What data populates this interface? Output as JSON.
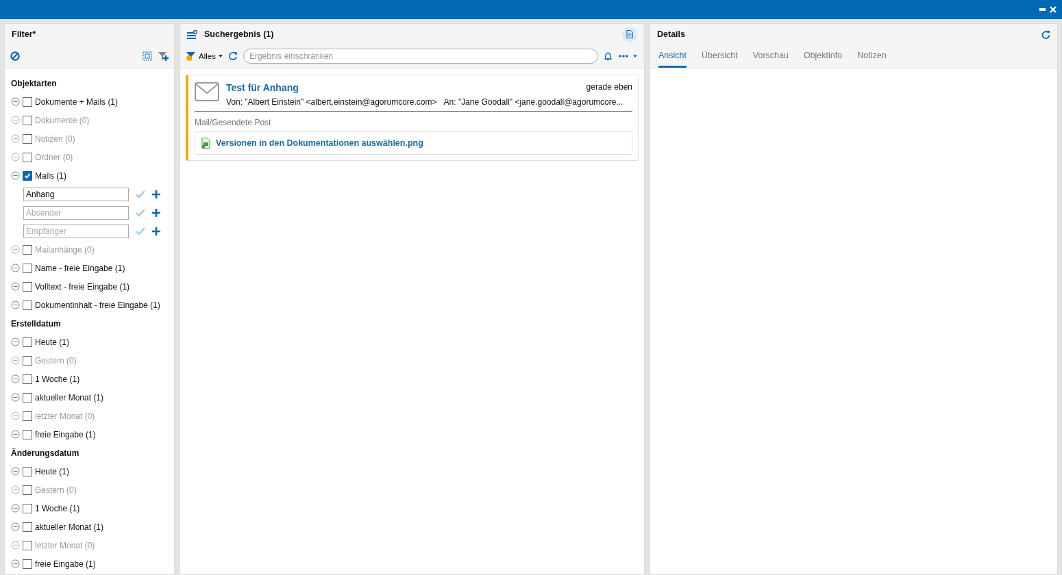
{
  "filter": {
    "title": "Filter*",
    "sections": [
      {
        "heading": "Objektarten",
        "items": [
          {
            "label": "Dokumente + Mails (1)",
            "checked": false,
            "disabled": false
          },
          {
            "label": "Dokumente (0)",
            "checked": false,
            "disabled": true
          },
          {
            "label": "Notizen (0)",
            "checked": false,
            "disabled": true
          },
          {
            "label": "Ordner (0)",
            "checked": false,
            "disabled": true
          },
          {
            "label": "Mails (1)",
            "checked": true,
            "disabled": false,
            "fields": [
              {
                "value": "Anhang"
              },
              {
                "placeholder": "Absender"
              },
              {
                "placeholder": "Empfänger"
              }
            ]
          },
          {
            "label": "Mailanhänge (0)",
            "checked": false,
            "disabled": true
          },
          {
            "label": "Name - freie Eingabe (1)",
            "checked": false,
            "disabled": false
          },
          {
            "label": "Volltext - freie Eingabe (1)",
            "checked": false,
            "disabled": false
          },
          {
            "label": "Dokumentinhalt - freie Eingabe (1)",
            "checked": false,
            "disabled": false
          }
        ]
      },
      {
        "heading": "Erstelldatum",
        "items": [
          {
            "label": "Heute (1)",
            "checked": false,
            "disabled": false
          },
          {
            "label": "Gestern (0)",
            "checked": false,
            "disabled": true
          },
          {
            "label": "1 Woche (1)",
            "checked": false,
            "disabled": false
          },
          {
            "label": "aktueller Monat (1)",
            "checked": false,
            "disabled": false
          },
          {
            "label": "letzter Monat (0)",
            "checked": false,
            "disabled": true
          },
          {
            "label": "freie Eingabe (1)",
            "checked": false,
            "disabled": false
          }
        ]
      },
      {
        "heading": "Änderungsdatum",
        "items": [
          {
            "label": "Heute (1)",
            "checked": false,
            "disabled": false
          },
          {
            "label": "Gestern (0)",
            "checked": false,
            "disabled": true
          },
          {
            "label": "1 Woche (1)",
            "checked": false,
            "disabled": false
          },
          {
            "label": "aktueller Monat (1)",
            "checked": false,
            "disabled": false
          },
          {
            "label": "letzter Monat (0)",
            "checked": false,
            "disabled": true
          },
          {
            "label": "freie Eingabe (1)",
            "checked": false,
            "disabled": false
          }
        ]
      }
    ]
  },
  "results": {
    "title": "Suchergebnis (1)",
    "scope": "Alles",
    "search": {
      "placeholder": "Ergebnis einschränken"
    },
    "items": [
      {
        "subject": "Test für Anhang",
        "time": "gerade eben",
        "from": "Von: \"Albert Einstein\" <albert.einstein@agorumcore.com>",
        "to": "An: \"Jane Goodall\" <jane.goodall@agorumcore...",
        "path": "Mail/Gesendete Post",
        "attachment": "Versionen in den Dokumentationen auswählen.png"
      }
    ]
  },
  "details": {
    "title": "Details",
    "tabs": [
      {
        "label": "Ansicht",
        "selected": true
      },
      {
        "label": "Übersicht",
        "selected": false
      },
      {
        "label": "Vorschau",
        "selected": false
      },
      {
        "label": "Objektinfo",
        "selected": false
      },
      {
        "label": "Notizen",
        "selected": false
      }
    ]
  }
}
